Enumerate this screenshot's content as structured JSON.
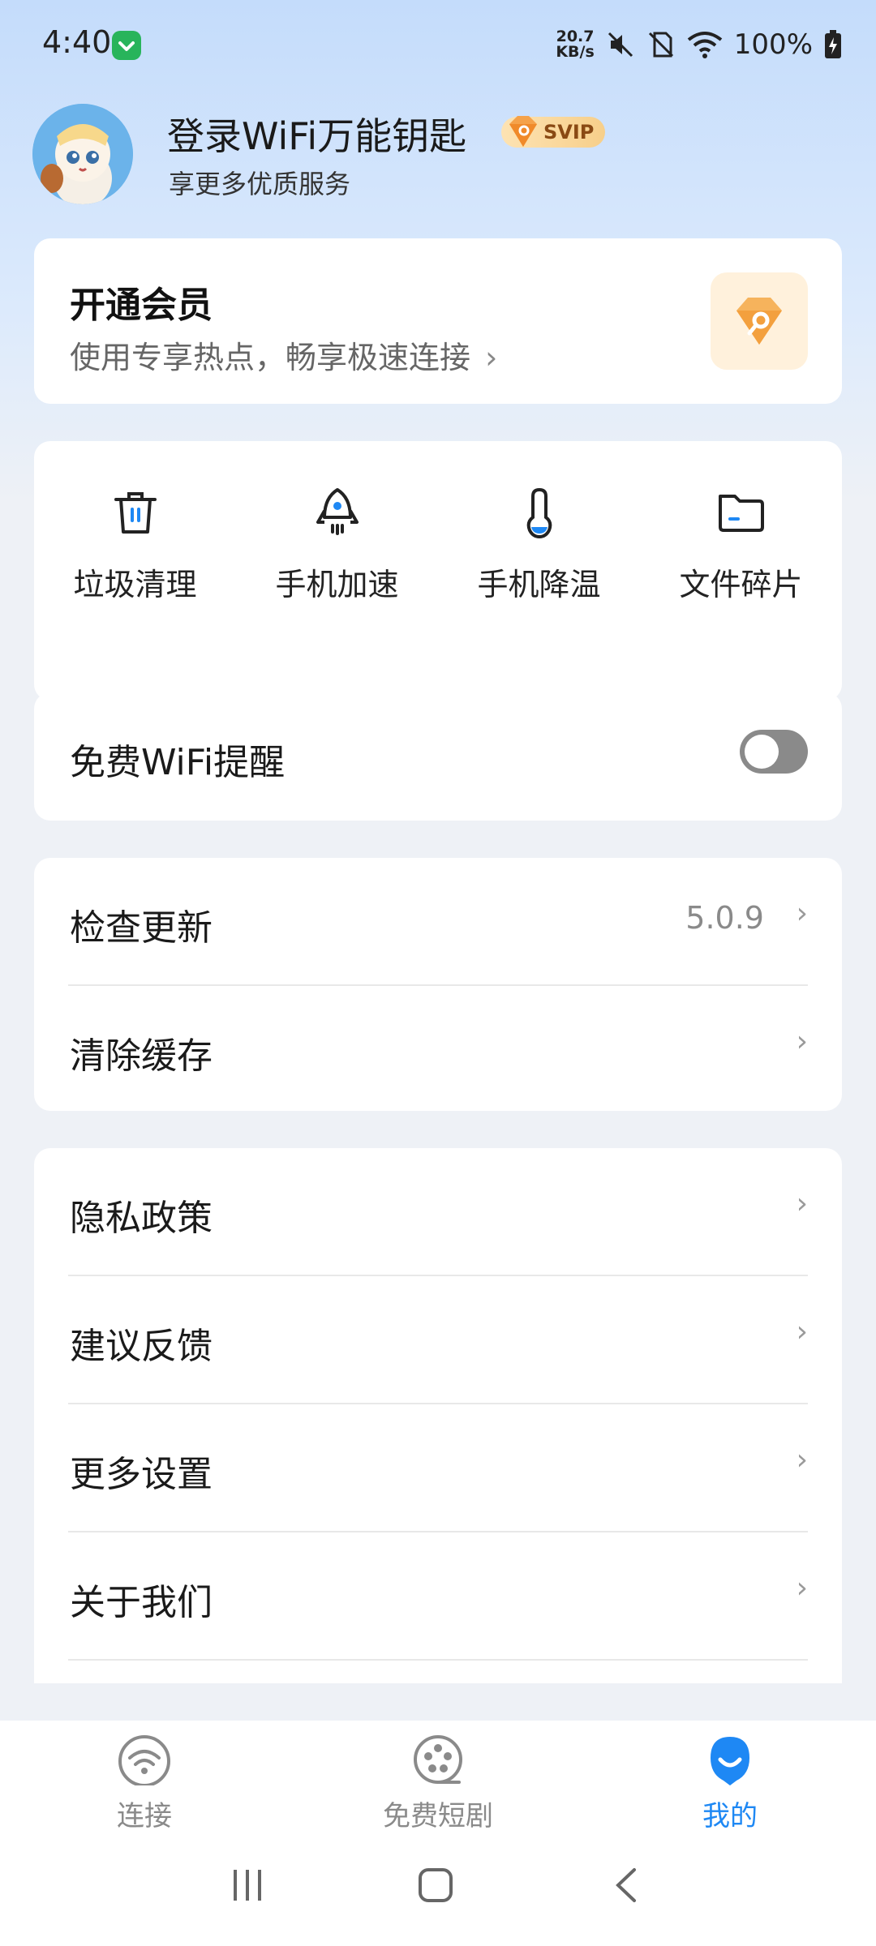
{
  "status_bar": {
    "time": "4:40",
    "net_speed_value": "20.7",
    "net_speed_unit": "KB/s",
    "battery": "100%"
  },
  "header": {
    "title": "登录WiFi万能钥匙",
    "badge": "SVIP",
    "subtitle": "享更多优质服务"
  },
  "vip_card": {
    "title": "开通会员",
    "subtitle": "使用专享热点，畅享极速连接",
    "arrow": "›"
  },
  "tools": [
    {
      "label": "垃圾清理",
      "icon": "trash-icon"
    },
    {
      "label": "手机加速",
      "icon": "rocket-icon"
    },
    {
      "label": "手机降温",
      "icon": "thermometer-icon"
    },
    {
      "label": "文件碎片",
      "icon": "folder-icon"
    }
  ],
  "wifi_reminder": {
    "label": "免费WiFi提醒",
    "enabled": false
  },
  "settings_group1": [
    {
      "label": "检查更新",
      "value": "5.0.9"
    },
    {
      "label": "清除缓存"
    }
  ],
  "settings_group2": [
    {
      "label": "隐私政策"
    },
    {
      "label": "建议反馈"
    },
    {
      "label": "更多设置"
    },
    {
      "label": "关于我们"
    }
  ],
  "chevron": "›",
  "bottom_nav": [
    {
      "label": "连接",
      "icon": "wifi-icon",
      "active": false
    },
    {
      "label": "免费短剧",
      "icon": "film-reel-icon",
      "active": false
    },
    {
      "label": "我的",
      "icon": "profile-icon",
      "active": true
    }
  ],
  "colors": {
    "accent": "#1e88f4",
    "vip_gold": "#f5a24a",
    "toggle_off": "#8a8a8a"
  }
}
